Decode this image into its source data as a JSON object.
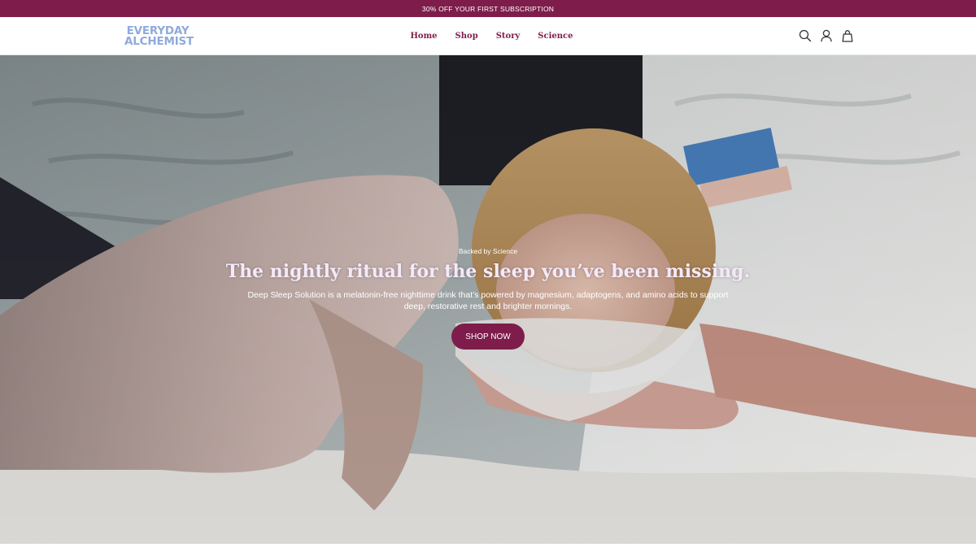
{
  "announcement": {
    "text": "30% OFF YOUR FIRST SUBSCRIPTION"
  },
  "header": {
    "logo_line1": "EVERYDAY",
    "logo_line2": "ALCHEMIST",
    "nav": [
      {
        "label": "Home"
      },
      {
        "label": "Shop"
      },
      {
        "label": "Story"
      },
      {
        "label": "Science"
      }
    ],
    "icons": [
      "search-icon",
      "account-icon",
      "cart-icon"
    ]
  },
  "hero": {
    "eyebrow": "Backed by Science",
    "headline": "The nightly ritual for the sleep you’ve been missing.",
    "subtitle": "Deep Sleep Solution is a melatonin-free nighttime drink that’s powered by magnesium, adaptogens, and amino acids to support deep, restorative rest and brighter mornings.",
    "cta_label": "SHOP NOW"
  },
  "colors": {
    "brand": "#7e1d4b",
    "logo": "#8faadc",
    "hero_text": "#ffffff"
  }
}
